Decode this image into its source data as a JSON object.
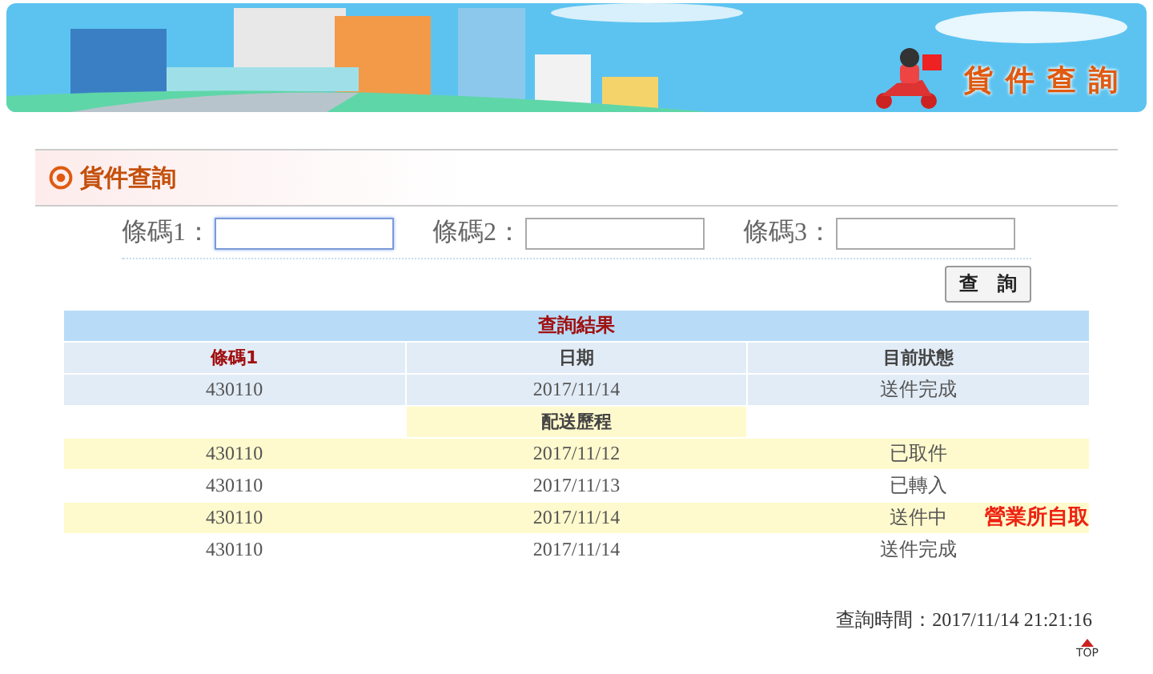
{
  "banner": {
    "title": "貨件查詢"
  },
  "section": {
    "title": "貨件查詢"
  },
  "fields": [
    {
      "label": "條碼1：",
      "focused": true
    },
    {
      "label": "條碼2：",
      "focused": false
    },
    {
      "label": "條碼3：",
      "focused": false
    }
  ],
  "search_button": "查　詢",
  "results": {
    "title": "查詢結果",
    "columns": [
      "條碼1",
      "日期",
      "目前狀態"
    ],
    "rows": [
      {
        "barcode": "430110",
        "date": "2017/11/14",
        "status": "送件完成"
      }
    ],
    "history_title": "配送歷程",
    "history": [
      {
        "barcode": "430110",
        "date": "2017/11/12",
        "status": "已取件"
      },
      {
        "barcode": "430110",
        "date": "2017/11/13",
        "status": "已轉入"
      },
      {
        "barcode": "430110",
        "date": "2017/11/14",
        "status": "送件中",
        "note": "營業所自取"
      },
      {
        "barcode": "430110",
        "date": "2017/11/14",
        "status": "送件完成"
      }
    ]
  },
  "query_time": "查詢時間：2017/11/14 21:21:16",
  "top_link": "TOP"
}
